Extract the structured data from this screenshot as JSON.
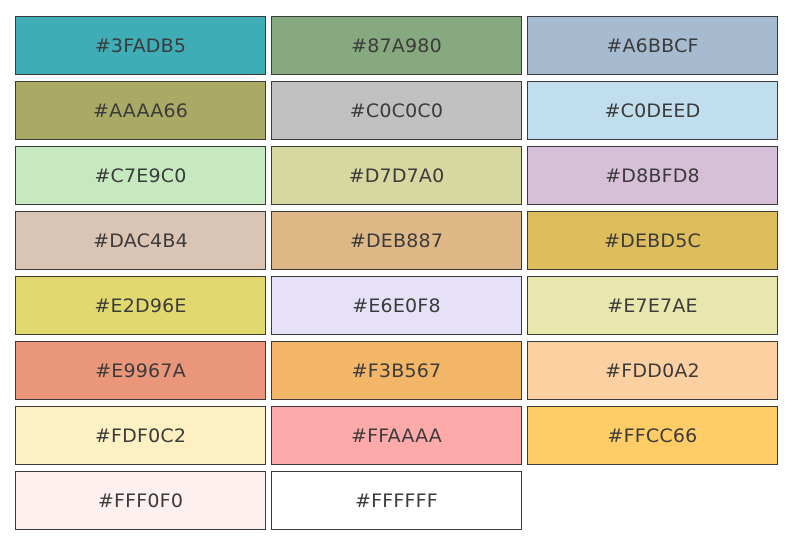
{
  "swatches": [
    {
      "hex": "#3FADB5",
      "color": "#3FADB5"
    },
    {
      "hex": "#87A980",
      "color": "#87A980"
    },
    {
      "hex": "#A6BBCF",
      "color": "#A6BBCF"
    },
    {
      "hex": "#AAAA66",
      "color": "#AAAA66"
    },
    {
      "hex": "#C0C0C0",
      "color": "#C0C0C0"
    },
    {
      "hex": "#C0DEED",
      "color": "#C0DEED"
    },
    {
      "hex": "#C7E9C0",
      "color": "#C7E9C0"
    },
    {
      "hex": "#D7D7A0",
      "color": "#D7D7A0"
    },
    {
      "hex": "#D8BFD8",
      "color": "#D8BFD8"
    },
    {
      "hex": "#DAC4B4",
      "color": "#DAC4B4"
    },
    {
      "hex": "#DEB887",
      "color": "#DEB887"
    },
    {
      "hex": "#DEBD5C",
      "color": "#DEBD5C"
    },
    {
      "hex": "#E2D96E",
      "color": "#E2D96E"
    },
    {
      "hex": "#E6E0F8",
      "color": "#E6E0F8"
    },
    {
      "hex": "#E7E7AE",
      "color": "#E7E7AE"
    },
    {
      "hex": "#E9967A",
      "color": "#E9967A"
    },
    {
      "hex": "#F3B567",
      "color": "#F3B567"
    },
    {
      "hex": "#FDD0A2",
      "color": "#FDD0A2"
    },
    {
      "hex": "#FDF0C2",
      "color": "#FDF0C2"
    },
    {
      "hex": "#FFAAAA",
      "color": "#FFAAAA"
    },
    {
      "hex": "#FFCC66",
      "color": "#FFCC66"
    },
    {
      "hex": "#FFF0F0",
      "color": "#FFF0F0"
    },
    {
      "hex": "#FFFFFF",
      "color": "#FFFFFF"
    }
  ]
}
